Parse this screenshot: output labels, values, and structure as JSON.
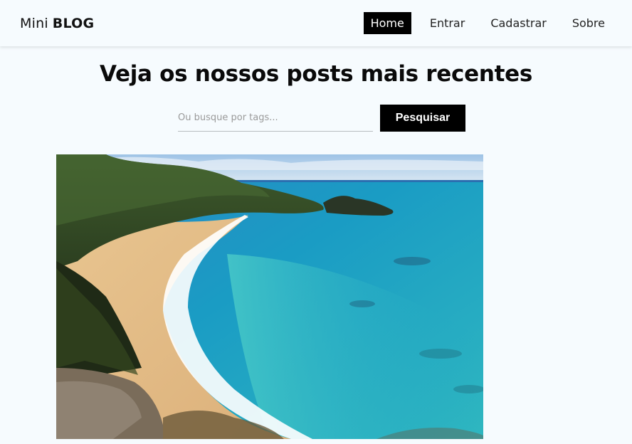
{
  "brand": {
    "light": "Mini",
    "bold": "BLOG"
  },
  "nav": {
    "items": [
      {
        "label": "Home",
        "active": true
      },
      {
        "label": "Entrar",
        "active": false
      },
      {
        "label": "Cadastrar",
        "active": false
      },
      {
        "label": "Sobre",
        "active": false
      }
    ]
  },
  "main": {
    "title": "Veja os nossos posts mais recentes"
  },
  "search": {
    "placeholder": "Ou busque por tags...",
    "value": "",
    "button_label": "Pesquisar"
  },
  "posts": [
    {
      "image": "beach-photo"
    }
  ],
  "colors": {
    "background": "#f6fbfe",
    "accent": "#000000",
    "sea": "#1a9cc4",
    "sand": "#e8c590"
  }
}
